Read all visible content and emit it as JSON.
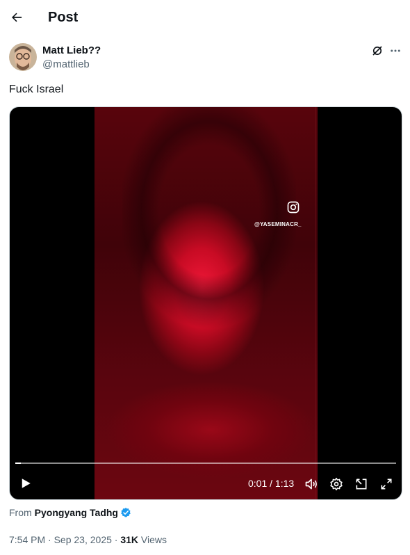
{
  "header": {
    "title": "Post"
  },
  "author": {
    "display_name": "Matt Lieb??",
    "handle": "@mattlieb"
  },
  "post": {
    "text": "Fuck Israel"
  },
  "video": {
    "watermark_handle": "@YASEMINACR_",
    "current_time": "0:01",
    "separator": " / ",
    "duration": "1:13",
    "progress": 0.014
  },
  "source": {
    "label": "From",
    "name": "Pyongyang Tadhg"
  },
  "meta": {
    "time": "7:54 PM",
    "dot1": " · ",
    "date": "Sep 23, 2025",
    "dot2": " · ",
    "views": "31K",
    "views_label": "Views"
  },
  "colors": {
    "verified": "#1d9bf0",
    "text": "#0f1419",
    "secondary": "#536471"
  }
}
